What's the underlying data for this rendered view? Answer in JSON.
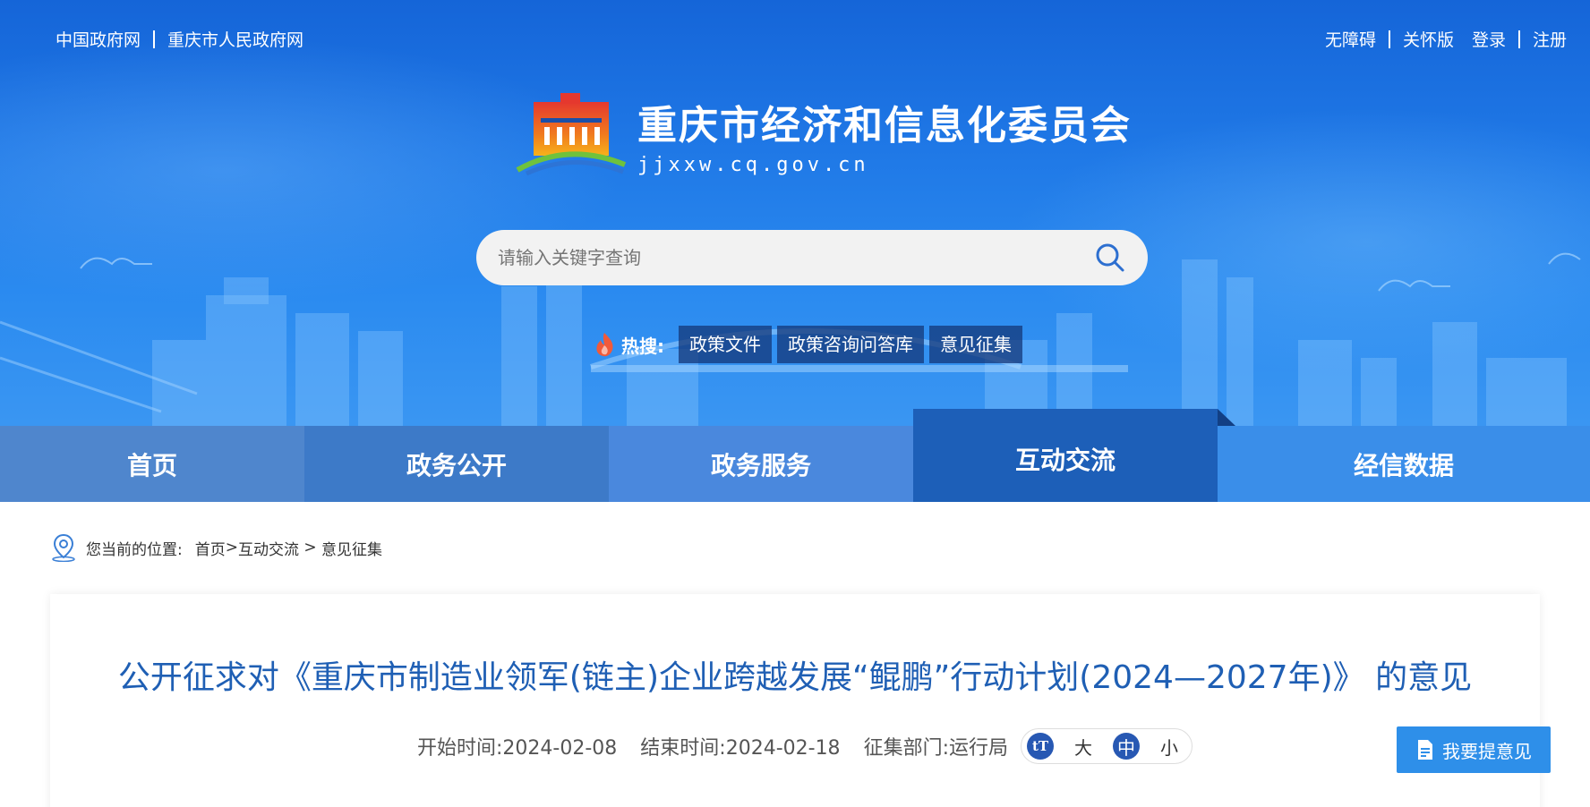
{
  "header": {
    "left_links": [
      "中国政府网",
      "重庆市人民政府网"
    ],
    "right_links": [
      "无障碍",
      "关怀版",
      "登录",
      "注册"
    ],
    "site_title": "重庆市经济和信息化委员会",
    "site_url": "jjxxw.cq.gov.cn"
  },
  "search": {
    "placeholder": "请输入关键字查询"
  },
  "hot_search": {
    "label": "热搜:",
    "tags": [
      "政策文件",
      "政策咨询问答库",
      "意见征集"
    ]
  },
  "nav": {
    "items": [
      "首页",
      "政务公开",
      "政务服务",
      "互动交流",
      "经信数据"
    ],
    "active": "互动交流"
  },
  "breadcrumb": {
    "prefix": "您当前的位置:",
    "items": [
      "首页",
      "互动交流",
      "意见征集"
    ]
  },
  "article": {
    "title": "公开征求对《重庆市制造业领军(链主)企业跨越发展“鲲鹏”行动计划(2024—2027年)》 的意见",
    "start_label": "开始时间:",
    "start_date": "2024-02-08",
    "end_label": "结束时间:",
    "end_date": "2024-02-18",
    "dept_label": "征集部门:",
    "dept": "运行局",
    "font_sizes": [
      "大",
      "中",
      "小"
    ],
    "font_size_selected": "中",
    "feedback_button": "我要提意见"
  },
  "colors": {
    "banner": "#1f78e6",
    "nav_active": "#1d5fb8",
    "title_blue": "#1f5fb4",
    "button_blue": "#2e8fe9"
  }
}
